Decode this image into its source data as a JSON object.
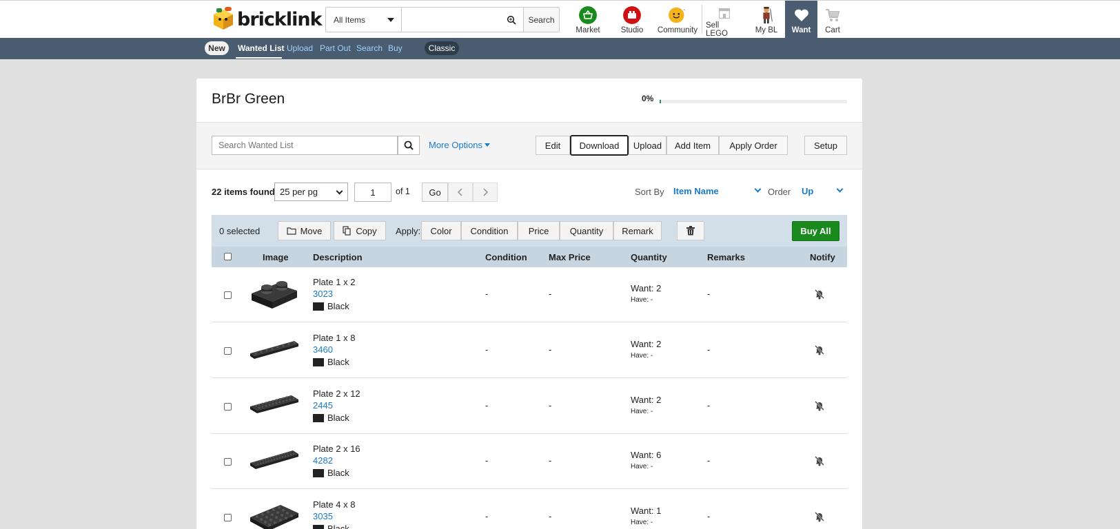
{
  "header": {
    "logo_text": "bricklink",
    "search_category": "All Items",
    "search_button": "Search",
    "nav": [
      {
        "label": "Market",
        "icon": "basket-icon",
        "color": "#1a8a1e"
      },
      {
        "label": "Studio",
        "icon": "studio-icon",
        "color": "#d01012"
      },
      {
        "label": "Community",
        "icon": "minifig-face-icon",
        "color": "#f5b21a"
      },
      {
        "label": "Sell LEGO",
        "icon": "storefront-icon",
        "color": "#bbbbbb"
      },
      {
        "label": "My BL",
        "icon": "avatar-icon",
        "color": "#8a3a2a"
      },
      {
        "label": "Want",
        "icon": "heart-icon",
        "color": "#ffffff"
      },
      {
        "label": "Cart",
        "icon": "cart-icon",
        "color": "#bbbbbb"
      }
    ]
  },
  "subnav": {
    "new_badge": "New",
    "links": [
      "Wanted List",
      "Upload",
      "Part Out",
      "Search",
      "Buy"
    ],
    "active": "Wanted List",
    "classic_badge": "Classic"
  },
  "list": {
    "title": "BrBr Green",
    "progress_percent": "0%",
    "progress_value": 0,
    "search_placeholder": "Search Wanted List",
    "more_options": "More Options",
    "actions": [
      "Edit",
      "Download",
      "Upload",
      "Add Item",
      "Apply Order"
    ],
    "focused_action": "Download",
    "setup": "Setup"
  },
  "paging": {
    "items_found": "22 items found",
    "per_page": "25 per pg",
    "page": "1",
    "of": "of 1",
    "go": "Go",
    "sort_by_label": "Sort By",
    "sort_by_value": "Item Name",
    "order_label": "Order",
    "order_value": "Up"
  },
  "actionbar": {
    "selected": "0 selected",
    "move": "Move",
    "copy": "Copy",
    "apply_label": "Apply:",
    "apply_buttons": [
      "Color",
      "Condition",
      "Price",
      "Quantity",
      "Remark"
    ],
    "buy_all": "Buy All"
  },
  "table": {
    "headers": [
      "Image",
      "Description",
      "Condition",
      "Max Price",
      "Quantity",
      "Remarks",
      "Notify"
    ],
    "rows": [
      {
        "name": "Plate 1 x 2",
        "number": "3023",
        "color": "Black",
        "condition": "-",
        "max_price": "-",
        "want": "Want: 2",
        "have": "Have: -",
        "remarks": "-"
      },
      {
        "name": "Plate 1 x 8",
        "number": "3460",
        "color": "Black",
        "condition": "-",
        "max_price": "-",
        "want": "Want: 2",
        "have": "Have: -",
        "remarks": "-"
      },
      {
        "name": "Plate 2 x 12",
        "number": "2445",
        "color": "Black",
        "condition": "-",
        "max_price": "-",
        "want": "Want: 2",
        "have": "Have: -",
        "remarks": "-"
      },
      {
        "name": "Plate 2 x 16",
        "number": "4282",
        "color": "Black",
        "condition": "-",
        "max_price": "-",
        "want": "Want: 6",
        "have": "Have: -",
        "remarks": "-"
      },
      {
        "name": "Plate 4 x 8",
        "number": "3035",
        "color": "Black",
        "condition": "-",
        "max_price": "-",
        "want": "Want: 1",
        "have": "Have: -",
        "remarks": "-"
      }
    ]
  },
  "colors": {
    "accent_blue": "#1a7ac8",
    "nav_bar": "#4a5c6f",
    "buy_green": "#1a8a1e",
    "part_black": "#212121"
  }
}
